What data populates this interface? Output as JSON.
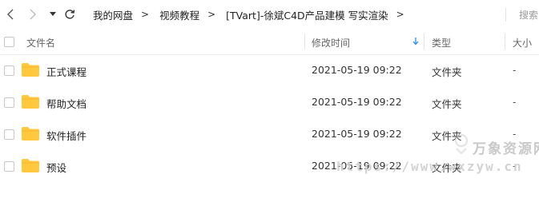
{
  "address_bar": {
    "breadcrumb": [
      "我的网盘",
      "视频教程",
      "[TVart]-徐斌C4D产品建模 写实渲染"
    ],
    "separator": ">",
    "trailing_separator": ">",
    "search_placeholder": "搜索"
  },
  "icons": {
    "back": "chevron-left-icon",
    "forward": "chevron-right-icon",
    "history": "caret-down-icon",
    "refresh": "refresh-icon",
    "sort": "arrow-down-icon",
    "folder": "folder-icon"
  },
  "columns": {
    "name": "文件名",
    "modified": "修改时间",
    "type": "类型",
    "size": "大小"
  },
  "sort": {
    "column": "modified",
    "direction": "descending"
  },
  "rows": [
    {
      "name": "正式课程",
      "modified": "2021-05-19 09:22",
      "type": "文件夹",
      "size": "-"
    },
    {
      "name": "帮助文档",
      "modified": "2021-05-19 09:22",
      "type": "文件夹",
      "size": "-"
    },
    {
      "name": "软件插件",
      "modified": "2021-05-19 09:22",
      "type": "文件夹",
      "size": "-"
    },
    {
      "name": "预设",
      "modified": "2021-05-19 09:22",
      "type": "文件夹",
      "size": "-"
    }
  ],
  "watermark": {
    "title": "万象资源网",
    "url": "https://www.wxzyw.cn"
  },
  "colors": {
    "folder": "#ffc83d",
    "accent": "#2d8cf0"
  }
}
